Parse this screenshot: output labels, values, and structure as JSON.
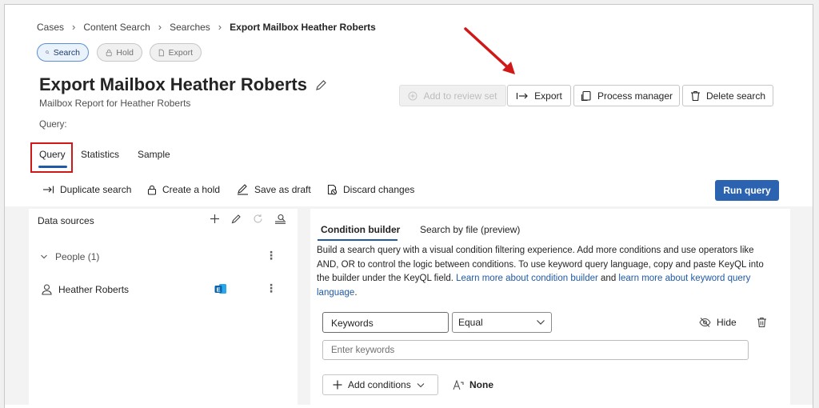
{
  "breadcrumb": {
    "items": [
      "Cases",
      "Content Search",
      "Searches"
    ],
    "current": "Export Mailbox Heather Roberts"
  },
  "pills": {
    "search": "Search",
    "hold": "Hold",
    "export": "Export"
  },
  "header": {
    "title": "Export Mailbox Heather Roberts",
    "subtitle": "Mailbox Report for Heather Roberts",
    "query_label": "Query:"
  },
  "actions": {
    "add_to_review_set": "Add to review set",
    "export": "Export",
    "process_manager": "Process manager",
    "delete_search": "Delete search"
  },
  "tabs": [
    "Query",
    "Statistics",
    "Sample"
  ],
  "toolbar": {
    "duplicate": "Duplicate search",
    "create_hold": "Create a hold",
    "save_draft": "Save as draft",
    "discard": "Discard changes",
    "run_query": "Run query"
  },
  "data_sources": {
    "title": "Data sources",
    "people_group": "People (1)",
    "user": "Heather Roberts"
  },
  "condition_builder": {
    "tabs": [
      "Condition builder",
      "Search by file (preview)"
    ],
    "description_plain": "Build a search query with a visual condition filtering experience. Add more conditions and use operators like AND, OR to control the logic between conditions. To use keyword query language, copy and paste KeyQL into the builder under the KeyQL field. ",
    "link1": "Learn more about condition builder",
    "and_text": " and ",
    "link2": "learn more about keyword query language",
    "period": ".",
    "keywords_label": "Keywords",
    "operator_value": "Equal",
    "hide_label": "Hide",
    "input_placeholder": "Enter keywords",
    "add_conditions": "Add conditions",
    "none_label": "None"
  },
  "colors": {
    "accent": "#2b63b0",
    "highlight_red": "#d11818",
    "link": "#1f5aa6"
  }
}
